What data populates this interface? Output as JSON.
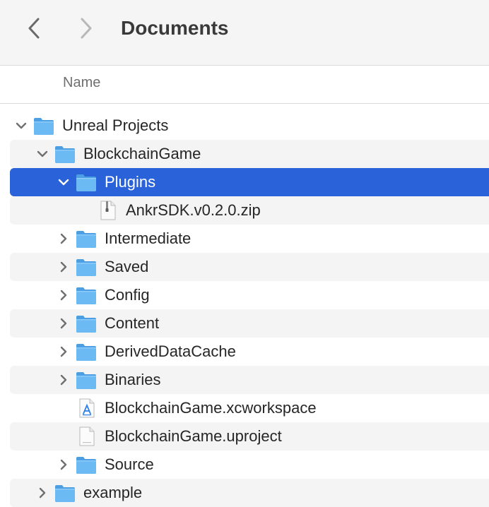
{
  "window": {
    "title": "Documents",
    "back_icon": "chevron-left-icon",
    "forward_icon": "chevron-right-icon"
  },
  "header": {
    "name_column": "Name"
  },
  "colors": {
    "selection": "#2a62d9",
    "folder": "#5aaef0",
    "alt_row": "#f4f4f4"
  },
  "items": [
    {
      "label": "Unreal Projects",
      "icon": "folder-icon",
      "disclosure": "expanded",
      "depth": 0
    },
    {
      "label": "BlockchainGame",
      "icon": "folder-icon",
      "disclosure": "expanded",
      "depth": 1
    },
    {
      "label": "Plugins",
      "icon": "folder-icon",
      "disclosure": "expanded",
      "depth": 2,
      "selected": true
    },
    {
      "label": "AnkrSDK.v0.2.0.zip",
      "icon": "zip-file-icon",
      "disclosure": "none",
      "depth": 3
    },
    {
      "label": "Intermediate",
      "icon": "folder-icon",
      "disclosure": "collapsed",
      "depth": 2
    },
    {
      "label": "Saved",
      "icon": "folder-icon",
      "disclosure": "collapsed",
      "depth": 2
    },
    {
      "label": "Config",
      "icon": "folder-icon",
      "disclosure": "collapsed",
      "depth": 2
    },
    {
      "label": "Content",
      "icon": "folder-icon",
      "disclosure": "collapsed",
      "depth": 2
    },
    {
      "label": "DerivedDataCache",
      "icon": "folder-icon",
      "disclosure": "collapsed",
      "depth": 2
    },
    {
      "label": "Binaries",
      "icon": "folder-icon",
      "disclosure": "collapsed",
      "depth": 2
    },
    {
      "label": "BlockchainGame.xcworkspace",
      "icon": "xcode-workspace-icon",
      "disclosure": "none",
      "depth": 2
    },
    {
      "label": "BlockchainGame.uproject",
      "icon": "document-icon",
      "disclosure": "none",
      "depth": 2
    },
    {
      "label": "Source",
      "icon": "folder-icon",
      "disclosure": "collapsed",
      "depth": 2
    },
    {
      "label": "example",
      "icon": "folder-icon",
      "disclosure": "collapsed",
      "depth": 1
    }
  ]
}
